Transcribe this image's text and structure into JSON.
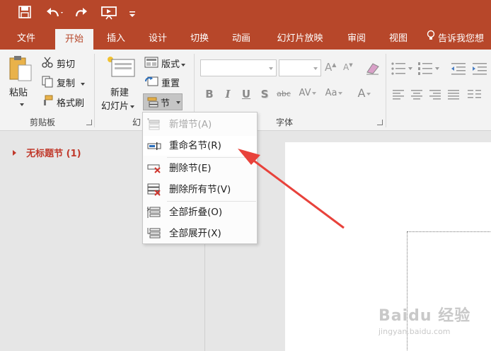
{
  "qat": {
    "save_icon": "save-icon",
    "undo_icon": "undo-icon",
    "redo_icon": "redo-icon",
    "present_icon": "present-icon",
    "customize_icon": "customize-icon"
  },
  "tabs": [
    {
      "label": "文件"
    },
    {
      "label": "开始"
    },
    {
      "label": "插入"
    },
    {
      "label": "设计"
    },
    {
      "label": "切换"
    },
    {
      "label": "动画"
    },
    {
      "label": "幻灯片放映"
    },
    {
      "label": "审阅"
    },
    {
      "label": "视图"
    }
  ],
  "tell_me": "告诉我您想",
  "clipboard": {
    "paste_label": "粘贴",
    "cut_label": "剪切",
    "copy_label": "复制",
    "format_painter_label": "格式刷",
    "group_label": "剪贴板"
  },
  "slides": {
    "new_slide_line1": "新建",
    "new_slide_line2": "幻灯片",
    "layout_label": "版式",
    "reset_label": "重置",
    "section_label": "节",
    "group_label": "幻"
  },
  "font": {
    "group_label": "字体",
    "bold": "B",
    "italic": "I",
    "underline": "U",
    "shadow": "S",
    "strike": "abc",
    "spacing": "AV",
    "case": "Aa",
    "color": "A"
  },
  "section_menu": {
    "items": [
      {
        "label": "新增节(A)",
        "icon": "add-section-icon",
        "disabled": true
      },
      {
        "label": "重命名节(R)",
        "icon": "rename-section-icon",
        "disabled": false
      },
      {
        "label": "删除节(E)",
        "icon": "remove-section-icon",
        "disabled": false
      },
      {
        "label": "删除所有节(V)",
        "icon": "remove-all-sections-icon",
        "disabled": false
      },
      {
        "label": "全部折叠(O)",
        "icon": "collapse-all-icon",
        "disabled": false
      },
      {
        "label": "全部展开(X)",
        "icon": "expand-all-icon",
        "disabled": false
      }
    ]
  },
  "left_pane": {
    "section_title": "无标题节 (1)"
  },
  "watermark": {
    "text": "Baidu 经验",
    "sub": "jingyan.baidu.com"
  },
  "colors": {
    "accent": "#b7472a",
    "arrow": "#e8423b"
  }
}
